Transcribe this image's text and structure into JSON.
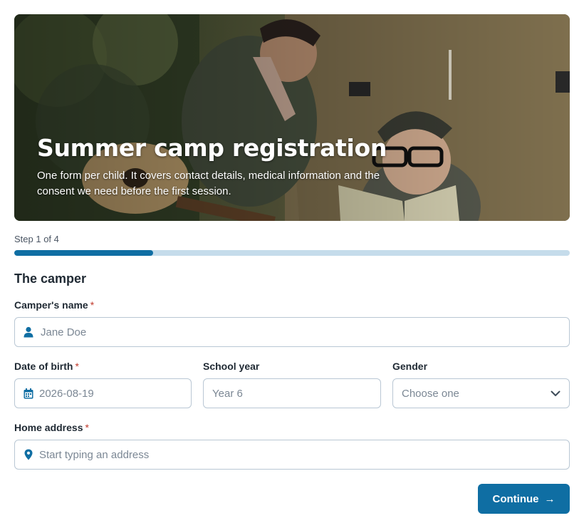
{
  "hero": {
    "title": "Summer camp registration",
    "subtitle": "One form per child. It covers contact details, medical information and the consent we need before the first session.",
    "image_subject": "two children scouts with a ukulele and a scout book in front of a tent"
  },
  "progress": {
    "step_label": "Step 1 of 4",
    "value": 0.25
  },
  "section": {
    "title": "The camper"
  },
  "fields": {
    "name": {
      "label": "Camper's name",
      "required_mark": "*",
      "placeholder": "Jane Doe",
      "icon": "person-icon"
    },
    "dob": {
      "label": "Date of birth",
      "required_mark": "*",
      "placeholder": "2026-08-19",
      "icon": "calendar-icon"
    },
    "school_year": {
      "label": "School year",
      "placeholder": "Year 6"
    },
    "gender": {
      "label": "Gender",
      "value": "Choose one",
      "icon": "chevron-down-icon"
    },
    "address": {
      "label": "Home address",
      "required_mark": "*",
      "placeholder": "Start typing an address",
      "icon": "map-pin-icon"
    }
  },
  "actions": {
    "continue_label": "Continue",
    "continue_arrow": "→"
  },
  "colors": {
    "accent": "#0f6ea3",
    "progress_track": "#c5dceb",
    "required": "#c0392b",
    "border": "#b9c7d4"
  }
}
